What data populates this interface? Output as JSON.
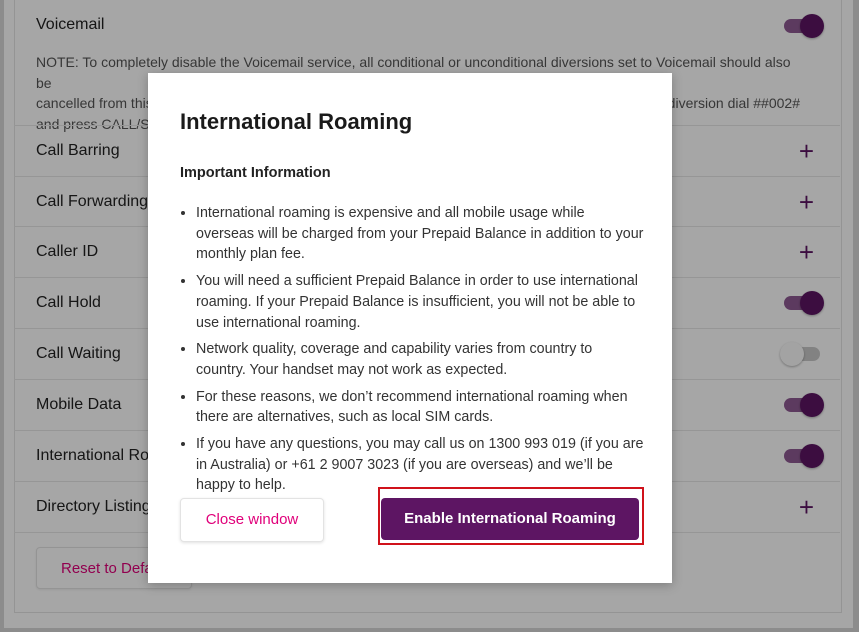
{
  "settings": {
    "voicemail": {
      "label": "Voicemail",
      "note": "NOTE: To completely disable the Voicemail service, all conditional or unconditional diversions set to Voicemail should also be cancelled from this [...] diversion dial ##002# and press CALL/S[...]",
      "note_line1": "NOTE: To completely disable the Voicemail service, all conditional or unconditional diversions set to Voicemail should also be",
      "note_line2_left": "cancelled from this",
      "note_line2_right": "diversion dial ##002#",
      "note_line3": "and press CALL/S",
      "enabled": true
    },
    "rows": [
      {
        "label": "Call Barring",
        "control": "plus"
      },
      {
        "label": "Call Forwarding",
        "control": "plus"
      },
      {
        "label": "Caller ID",
        "control": "plus"
      },
      {
        "label": "Call Hold",
        "control": "toggle",
        "enabled": true
      },
      {
        "label": "Call Waiting",
        "control": "toggle",
        "enabled": false
      },
      {
        "label": "Mobile Data",
        "control": "toggle",
        "enabled": true
      },
      {
        "label": "International Roa",
        "control": "toggle",
        "enabled": true
      },
      {
        "label": "Directory Listing",
        "control": "plus"
      }
    ],
    "reset_label": "Reset to Defa",
    "plus_symbol": "+"
  },
  "modal": {
    "title": "International Roaming",
    "subtitle": "Important Information",
    "bullets": [
      "International roaming is expensive and all mobile usage while overseas will be charged from your Prepaid Balance in addition to your monthly plan fee.",
      "You will need a sufficient Prepaid Balance in order to use international roaming. If your Prepaid Balance is insufficient, you will not be able to use international roaming.",
      "Network quality, coverage and capability varies from country to country. Your handset may not work as expected.",
      "For these reasons, we don’t recommend international roaming when there are alternatives, such as local SIM cards.",
      "If you have any questions, you may call us on 1300 993 019 (if you are in Australia) or +61 2 9007 3023 (if you are overseas) and we’ll be happy to help."
    ],
    "close_label": "Close window",
    "enable_label": "Enable International Roaming"
  },
  "colors": {
    "brand_purple": "#5d1563",
    "accent_pink": "#e0007a",
    "highlight_red": "#d0121b"
  }
}
